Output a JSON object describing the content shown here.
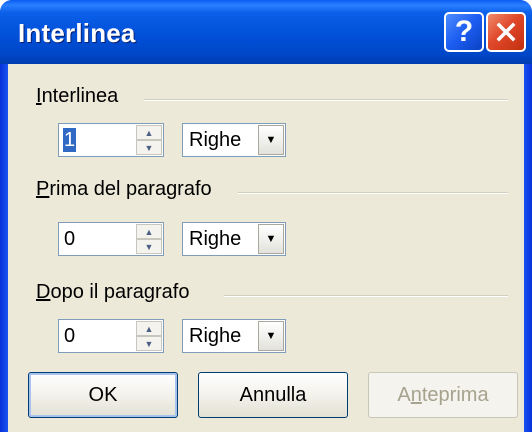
{
  "window": {
    "title": "Interlinea",
    "help_label": "?",
    "close_label": "✕"
  },
  "groups": [
    {
      "label_first": "I",
      "label_rest": "nterlinea",
      "value": "1",
      "unit": "Righe",
      "value_selected": true
    },
    {
      "label_first": "P",
      "label_rest": "rima del paragrafo",
      "value": "0",
      "unit": "Righe",
      "value_selected": false
    },
    {
      "label_first": "D",
      "label_rest": "opo il paragrafo",
      "value": "0",
      "unit": "Righe",
      "value_selected": false
    }
  ],
  "buttons": {
    "ok": "OK",
    "cancel": "Annulla",
    "preview_before": "A",
    "preview_mnemonic": "n",
    "preview_after": "teprima"
  },
  "icons": {
    "spin_up": "▲",
    "spin_down": "▼",
    "dropdown": "▼"
  },
  "colors": {
    "title_bar": "#0054e3",
    "dialog_face": "#ece9d8",
    "close_button": "#e0482a",
    "selection": "#316ac5"
  }
}
